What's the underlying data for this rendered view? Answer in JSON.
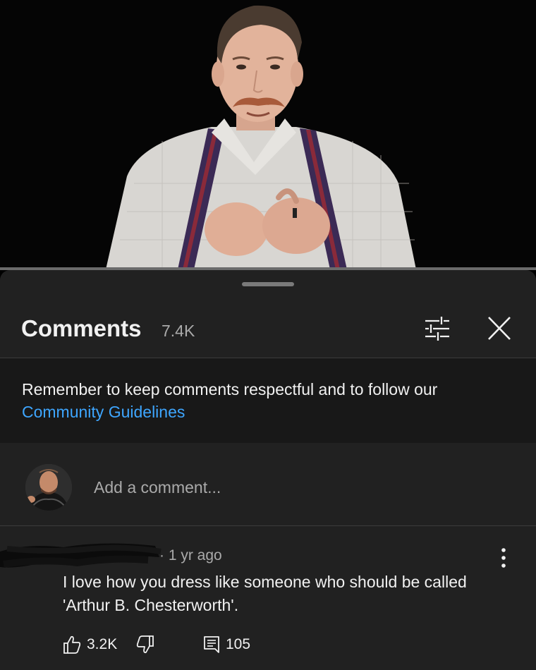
{
  "video": {
    "background": "#050505",
    "progress_color": "#6b6b6b"
  },
  "comments_panel": {
    "title": "Comments",
    "count": "7.4K",
    "filter_icon": "sliders-icon",
    "close_icon": "close-icon"
  },
  "notice": {
    "text": "Remember to keep comments respectful and to follow our",
    "link": "Community Guidelines",
    "link_color": "#3ea6ff"
  },
  "add_comment": {
    "placeholder": "Add a comment..."
  },
  "comment": {
    "author": "",
    "time": "· 1 yr ago",
    "text": "I love how you dress like someone who should be called 'Arthur B. Chesterworth'.",
    "likes": "3.2K",
    "replies": "105"
  },
  "colors": {
    "sheet": "#212121",
    "notice_bg": "#181818",
    "muted_text": "#aaaaaa"
  }
}
